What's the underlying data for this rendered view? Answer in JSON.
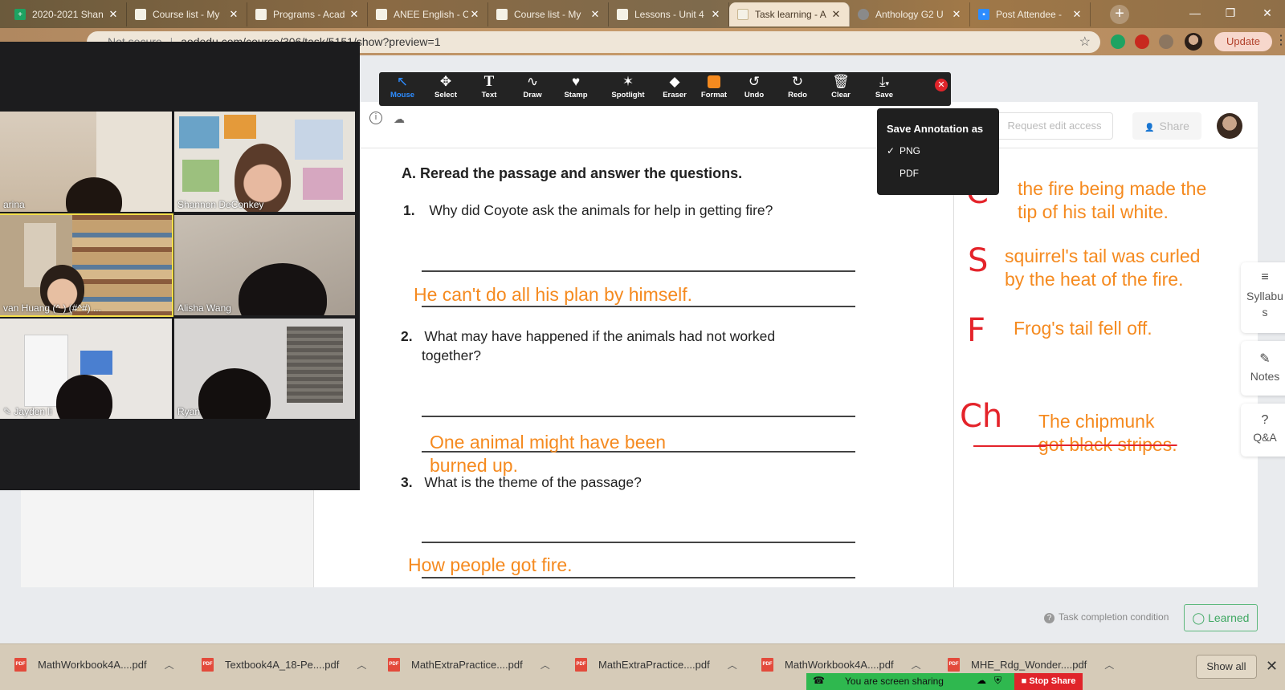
{
  "browser": {
    "tabs": [
      {
        "title": "2020-2021 Shan",
        "favicon_color": "#1ea362",
        "active": false
      },
      {
        "title": "Course list - My",
        "favicon_color": "#f4f1e6",
        "active": false
      },
      {
        "title": "Programs - Acad",
        "favicon_color": "#f4f1e6",
        "active": false
      },
      {
        "title": "ANEE English - C",
        "favicon_color": "#f4f1e6",
        "active": false
      },
      {
        "title": "Course list - My",
        "favicon_color": "#f4f1e6",
        "active": false
      },
      {
        "title": "Lessons - Unit 4",
        "favicon_color": "#f4f1e6",
        "active": false
      },
      {
        "title": "Task learning - A",
        "favicon_color": "#f4f1e6",
        "active": true
      },
      {
        "title": "Anthology G2 U",
        "favicon_color": "#8a8a8a",
        "active": false
      },
      {
        "title": "Post Attendee -",
        "favicon_color": "#2d8cff",
        "active": false
      }
    ],
    "url_prefix": "Not secure",
    "url": "aodedu.com/course/306/task/5151/show?preview=1",
    "update_label": "Update"
  },
  "annotation_toolbar": {
    "tools": [
      {
        "label": "Mouse",
        "icon": "cursor-icon",
        "glyph": "↖",
        "selected": true
      },
      {
        "label": "Select",
        "icon": "move-icon",
        "glyph": "✥",
        "selected": false
      },
      {
        "label": "Text",
        "icon": "text-icon",
        "glyph": "T",
        "selected": false
      },
      {
        "label": "Draw",
        "icon": "draw-icon",
        "glyph": "∿",
        "selected": false
      },
      {
        "label": "Stamp",
        "icon": "heart-icon",
        "glyph": "♥",
        "selected": false
      },
      {
        "label": "Spotlight",
        "icon": "wand-icon",
        "glyph": "✶",
        "selected": false
      },
      {
        "label": "Eraser",
        "icon": "eraser-icon",
        "glyph": "◆",
        "selected": false
      },
      {
        "label": "Format",
        "icon": "format-swatch-icon",
        "glyph": "",
        "selected": false
      },
      {
        "label": "Undo",
        "icon": "undo-icon",
        "glyph": "↺",
        "selected": false
      },
      {
        "label": "Redo",
        "icon": "redo-icon",
        "glyph": "↻",
        "selected": false
      },
      {
        "label": "Clear",
        "icon": "trash-icon",
        "glyph": "✖",
        "selected": false
      },
      {
        "label": "Save",
        "icon": "save-icon",
        "glyph": "⤓",
        "selected": false
      }
    ],
    "save_menu": {
      "title": "Save Annotation as",
      "options": [
        "PNG",
        "PDF"
      ],
      "selected": "PNG"
    },
    "accent": "#2d8cff",
    "format_color": "#f58a1f"
  },
  "zoom": {
    "participants": [
      "arina",
      "Shannon DeConkey",
      "van Huang (^ ) (#^#) ...",
      "Alisha Wang",
      "Jayden li",
      "Ryan"
    ],
    "share_banner": "You are screen sharing",
    "stop_share": "Stop Share"
  },
  "doc_header": {
    "request_edit": "Request edit access",
    "share": "Share"
  },
  "worksheet": {
    "heading": "A. Reread the passage and answer the questions.",
    "q1_num": "1.",
    "q1": "Why did Coyote ask the animals for help in getting fire?",
    "a1": "He can't do all his plan by himself.",
    "q2_num": "2.",
    "q2_line1": "What may have happened if the animals had not worked",
    "q2_line2": "together?",
    "a2_line1": "One animal might have been",
    "a2_line2": "burned up.",
    "q3_num": "3.",
    "q3": "What is the theme of the passage?",
    "a3": "How people got fire."
  },
  "annotations": {
    "c_letter": "C",
    "c_text_1": "the fire being made the",
    "c_text_2": "tip of his tail white.",
    "s_letter": "S",
    "s_text_1": "squirrel's tail was curled",
    "s_text_2": "by the heat of the fire.",
    "f_letter": "F",
    "f_text": "Frog's tail fell off.",
    "ch_letters": "Ch",
    "ch_text_1": "The chipmunk",
    "ch_text_2": "got black stripes.",
    "ink_color": "#f58a1f",
    "pen_color": "#e4232a"
  },
  "side_buttons": {
    "syllabus": "Syllabus",
    "notes": "Notes",
    "qa": "Q&A"
  },
  "footer": {
    "task_completion": "Task completion condition",
    "learned": "Learned"
  },
  "downloads": {
    "items": [
      "MathWorkbook4A....pdf",
      "Textbook4A_18-Pe....pdf",
      "MathExtraPractice....pdf",
      "MathExtraPractice....pdf",
      "MathWorkbook4A....pdf",
      "MHE_Rdg_Wonder....pdf"
    ],
    "show_all": "Show all"
  }
}
